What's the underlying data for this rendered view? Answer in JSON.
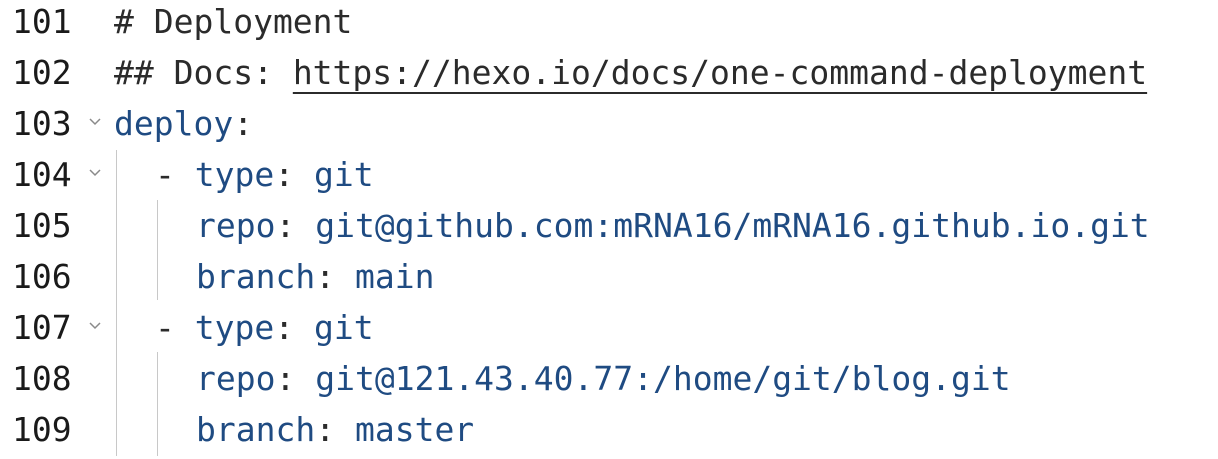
{
  "editor": {
    "lines": [
      {
        "num": "101",
        "fold": false
      },
      {
        "num": "102",
        "fold": false
      },
      {
        "num": "103",
        "fold": true
      },
      {
        "num": "104",
        "fold": true
      },
      {
        "num": "105",
        "fold": false
      },
      {
        "num": "106",
        "fold": false
      },
      {
        "num": "107",
        "fold": true
      },
      {
        "num": "108",
        "fold": false
      },
      {
        "num": "109",
        "fold": false
      }
    ],
    "text": {
      "l101": "# Deployment",
      "l102_prefix": "## Docs: ",
      "l102_link": "https://hexo.io/docs/one-command-deployment",
      "l103_key": "deploy",
      "l104_dash": "- ",
      "l104_key": "type",
      "l104_val": "git",
      "l105_key": "repo",
      "l105_val": "git@github.com:mRNA16/mRNA16.github.io.git",
      "l106_key": "branch",
      "l106_val": "main",
      "l107_dash": "- ",
      "l107_key": "type",
      "l107_val": "git",
      "l108_key": "repo",
      "l108_val": "git@121.43.40.77:/home/git/blog.git",
      "l109_key": "branch",
      "l109_val": "master",
      "colon": ": ",
      "colon_end": ":"
    },
    "colors": {
      "key": "#1f4b82",
      "comment": "#2b2b2b",
      "guide": "#c8c8c8"
    }
  }
}
